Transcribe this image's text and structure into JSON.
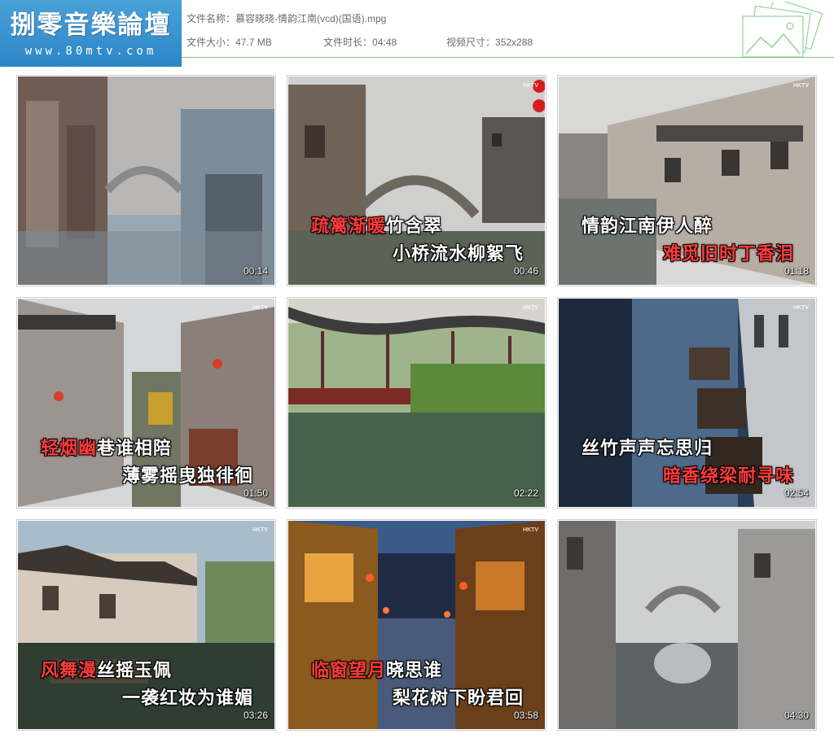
{
  "header": {
    "logo_title": "捌零音樂論壇",
    "logo_url": "www.80mtv.com",
    "file_name_label": "文件名称：",
    "file_name": "慕容晓晓-情韵江南(vcd)(国语).mpg",
    "file_size_label": "文件大小：",
    "file_size": "47.7 MB",
    "duration_label": "文件时长：",
    "duration": "04:48",
    "resolution_label": "视频尺寸：",
    "resolution": "352x288"
  },
  "thumbnails": [
    {
      "time": "00:14",
      "watermark": "",
      "line1_hl": "",
      "line1_rest": "",
      "line2_hl": "",
      "line2_rest": ""
    },
    {
      "time": "00:46",
      "watermark": "HKTV",
      "line1_hl": "疏篱渐暖",
      "line1_rest": "竹含翠",
      "line2_hl": "",
      "line2_rest": "小桥流水柳絮飞"
    },
    {
      "time": "01:18",
      "watermark": "HKTV",
      "line1_hl": "",
      "line1_rest": "情韵江南伊人醉",
      "line2_hl": "难觅旧时丁香泪",
      "line2_rest": ""
    },
    {
      "time": "01:50",
      "watermark": "HKTV",
      "line1_hl": "轻烟幽",
      "line1_rest": "巷谁相陪",
      "line2_hl": "",
      "line2_rest": "薄雾摇曳独徘徊"
    },
    {
      "time": "02:22",
      "watermark": "HKTV",
      "line1_hl": "",
      "line1_rest": "",
      "line2_hl": "",
      "line2_rest": ""
    },
    {
      "time": "02:54",
      "watermark": "HKTV",
      "line1_hl": "",
      "line1_rest": "丝竹声声忘思归",
      "line2_hl": "暗香绕梁耐寻味",
      "line2_rest": ""
    },
    {
      "time": "03:26",
      "watermark": "HKTV",
      "line1_hl": "风舞漫",
      "line1_rest": "丝摇玉佩",
      "line2_hl": "",
      "line2_rest": "一袭红妆为谁媚"
    },
    {
      "time": "03:58",
      "watermark": "HKTV",
      "line1_hl": "临窗望月",
      "line1_rest": "晓思谁",
      "line2_hl": "",
      "line2_rest": "梨花树下盼君回"
    },
    {
      "time": "04:30",
      "watermark": "",
      "line1_hl": "",
      "line1_rest": "",
      "line2_hl": "",
      "line2_rest": ""
    }
  ],
  "colors": {
    "logo_bg": "#2c85c6",
    "header_rule": "#7cc576",
    "lyric_highlight": "#ff3b3b",
    "lyric_normal": "#ffffff"
  }
}
